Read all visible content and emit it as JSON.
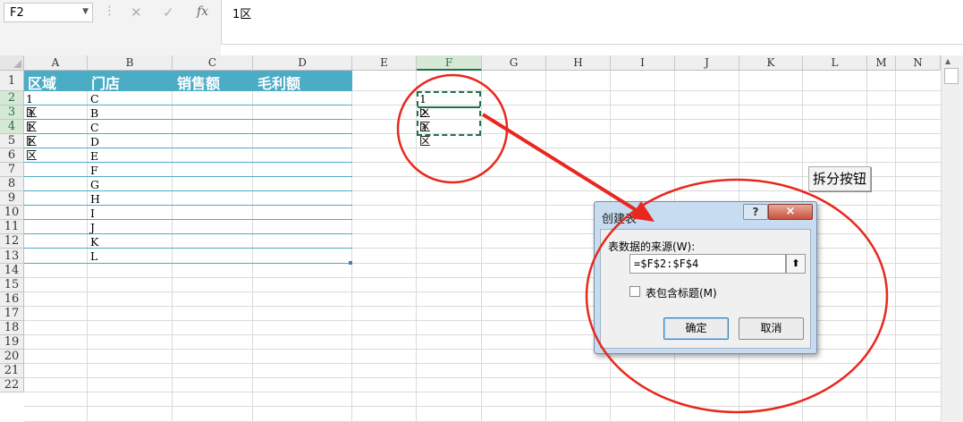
{
  "namebox": {
    "value": "F2"
  },
  "formula_bar": {
    "fx_label": "fx",
    "content": "1区"
  },
  "columns": [
    "A",
    "B",
    "C",
    "D",
    "E",
    "F",
    "G",
    "H",
    "I",
    "J",
    "K",
    "L",
    "M",
    "N"
  ],
  "selected_column": "F",
  "rows": [
    "1",
    "2",
    "3",
    "4",
    "5",
    "6",
    "7",
    "8",
    "9",
    "10",
    "11",
    "12",
    "13",
    "14",
    "15",
    "16",
    "17",
    "18",
    "19",
    "20",
    "21",
    "22"
  ],
  "table": {
    "headers": [
      "区域",
      "门店",
      "销售额",
      "毛利额"
    ],
    "region_col": [
      "1区",
      "3区",
      "1区",
      "1区",
      "",
      "",
      "",
      "",
      "",
      "",
      "",
      ""
    ],
    "store_col": [
      "C",
      "B",
      "C",
      "D",
      "E",
      "F",
      "G",
      "H",
      "I",
      "J",
      "K",
      "L"
    ]
  },
  "f_column_values": [
    "1区",
    "2区",
    "3区"
  ],
  "split_button": {
    "label": "拆分按钮"
  },
  "dialog": {
    "title": "创建表",
    "help_label": "?",
    "close_label": "×",
    "source_label": "表数据的来源(W):",
    "range_value": "=$F$2:$F$4",
    "collapse_label": "⬆",
    "header_checkbox_label": "表包含标题(M)",
    "ok_label": "确定",
    "cancel_label": "取消"
  },
  "colors": {
    "table_header": "#4bacc6",
    "table_line": "#4bacc6",
    "annotation": "#e8281e",
    "selection": "#217346"
  }
}
